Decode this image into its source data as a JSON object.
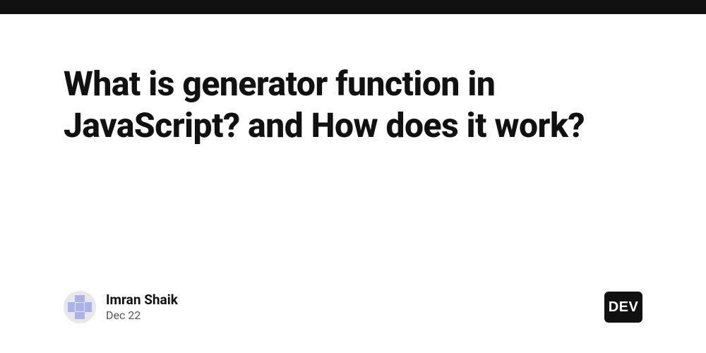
{
  "post": {
    "title": "What is generator function in JavaScript? and How does it work?"
  },
  "author": {
    "name": "Imran Shaik",
    "date": "Dec 22"
  },
  "brand": {
    "label": "DEV"
  }
}
